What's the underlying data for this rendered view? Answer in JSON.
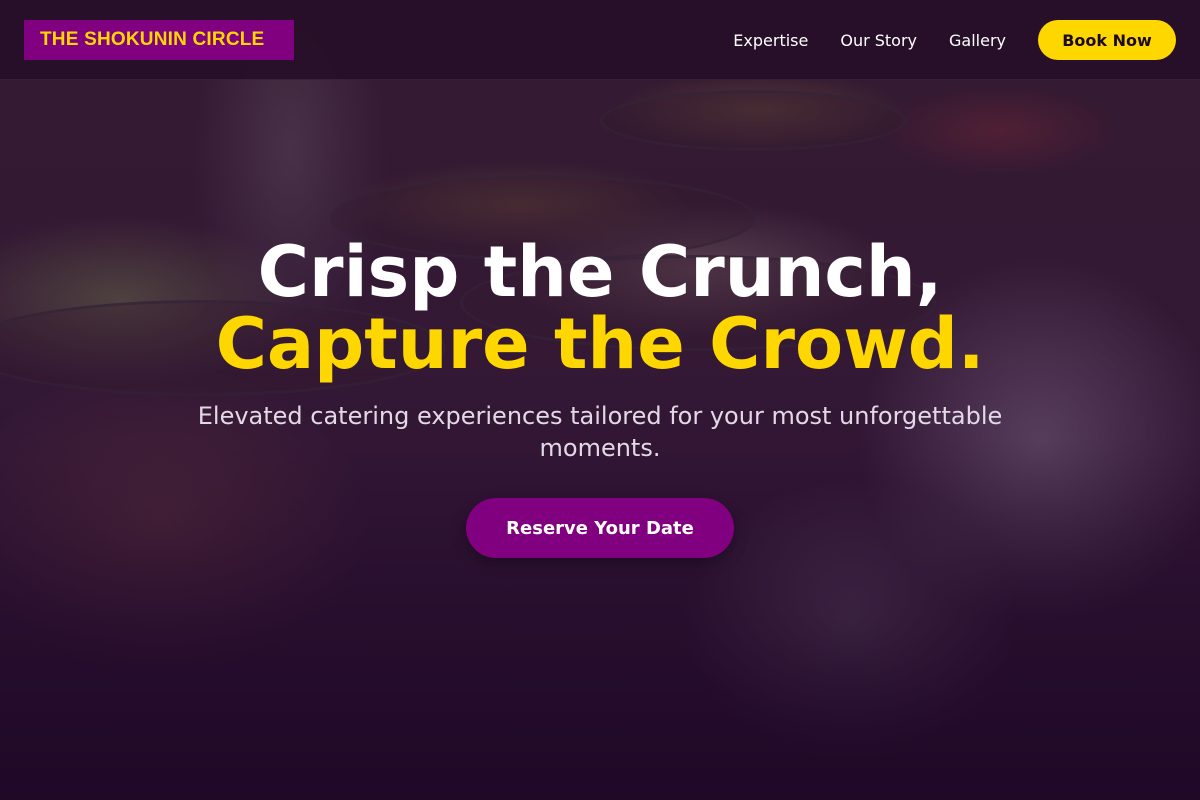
{
  "header": {
    "logo_text": "THE SHOKUNIN CIRCLE",
    "nav_items": [
      "Expertise",
      "Our Story",
      "Gallery"
    ],
    "book_button": "Book Now"
  },
  "hero": {
    "headline_line1": "Crisp the Crunch,",
    "headline_line2": "Capture the Crowd.",
    "subtitle": "Elevated catering experiences tailored for your most unforgettable moments.",
    "cta_label": "Reserve Your Date",
    "background_image": "catering-buffet-photo"
  },
  "colors": {
    "brand_purple": "#800080",
    "accent_gold": "#ffd700",
    "background_dark": "#1c0a1e"
  }
}
